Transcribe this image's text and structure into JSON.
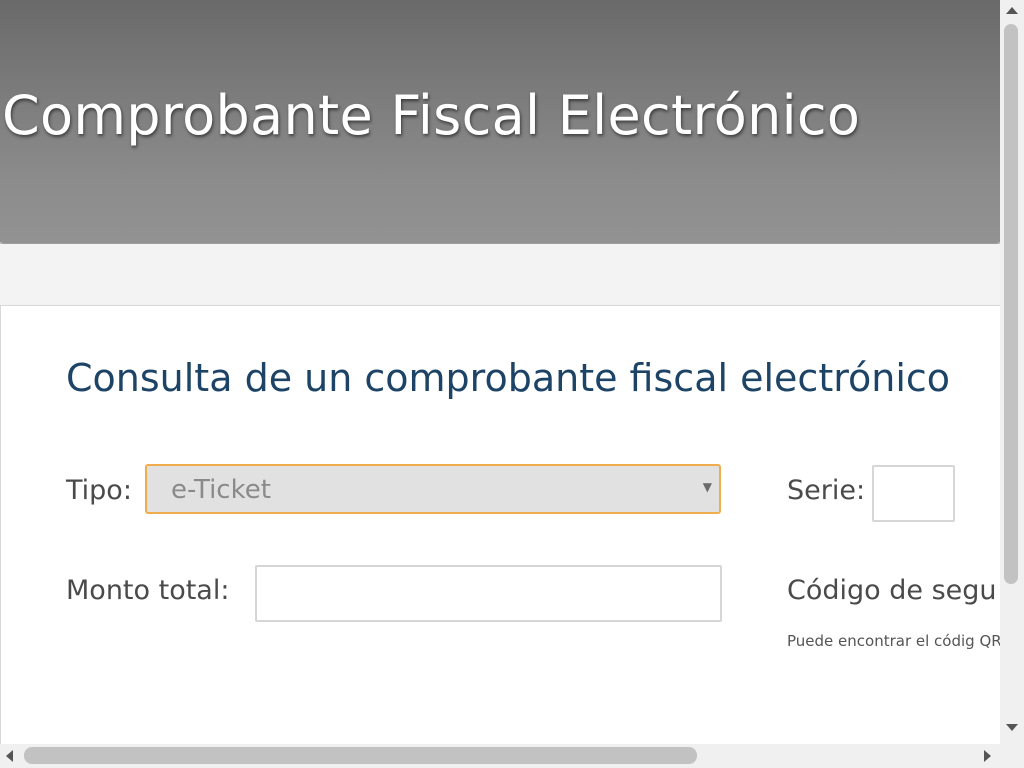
{
  "header": {
    "title": "Comprobante Fiscal Electrónico"
  },
  "form": {
    "title": "Consulta de un comprobante fiscal electrónico",
    "tipo_label": "Tipo:",
    "tipo_value": "e-Ticket",
    "tipo_arrow": "▼",
    "serie_label": "Serie:",
    "serie_value": "",
    "monto_label": "Monto total:",
    "monto_value": "",
    "codigo_label": "Código de segu",
    "hint_text": "Puede encontrar el códig QR."
  },
  "colors": {
    "title_blue": "#1d4466",
    "focus_border": "#f0ad4e",
    "header_gray": "#7a7a7a"
  }
}
